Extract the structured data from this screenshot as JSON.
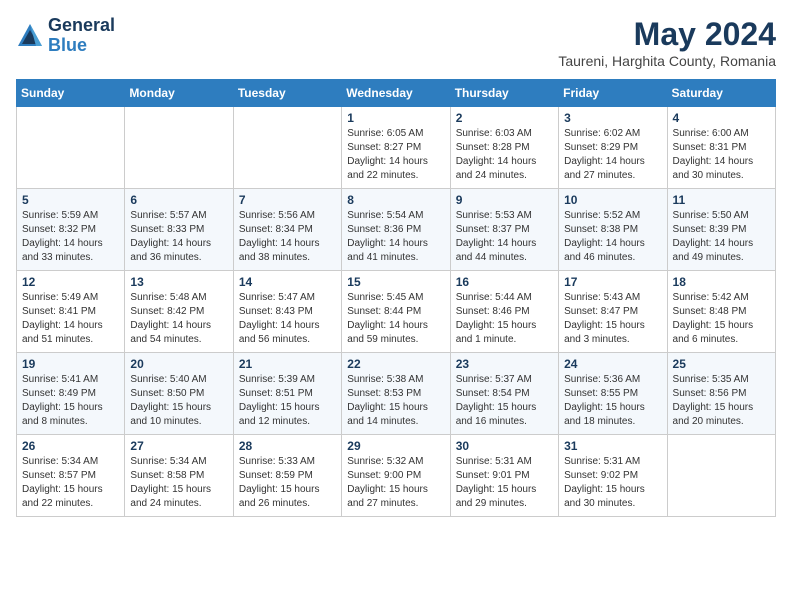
{
  "header": {
    "logo_general": "General",
    "logo_blue": "Blue",
    "month_title": "May 2024",
    "location": "Taureni, Harghita County, Romania"
  },
  "days_of_week": [
    "Sunday",
    "Monday",
    "Tuesday",
    "Wednesday",
    "Thursday",
    "Friday",
    "Saturday"
  ],
  "weeks": [
    [
      {
        "day": "",
        "info": ""
      },
      {
        "day": "",
        "info": ""
      },
      {
        "day": "",
        "info": ""
      },
      {
        "day": "1",
        "info": "Sunrise: 6:05 AM\nSunset: 8:27 PM\nDaylight: 14 hours\nand 22 minutes."
      },
      {
        "day": "2",
        "info": "Sunrise: 6:03 AM\nSunset: 8:28 PM\nDaylight: 14 hours\nand 24 minutes."
      },
      {
        "day": "3",
        "info": "Sunrise: 6:02 AM\nSunset: 8:29 PM\nDaylight: 14 hours\nand 27 minutes."
      },
      {
        "day": "4",
        "info": "Sunrise: 6:00 AM\nSunset: 8:31 PM\nDaylight: 14 hours\nand 30 minutes."
      }
    ],
    [
      {
        "day": "5",
        "info": "Sunrise: 5:59 AM\nSunset: 8:32 PM\nDaylight: 14 hours\nand 33 minutes."
      },
      {
        "day": "6",
        "info": "Sunrise: 5:57 AM\nSunset: 8:33 PM\nDaylight: 14 hours\nand 36 minutes."
      },
      {
        "day": "7",
        "info": "Sunrise: 5:56 AM\nSunset: 8:34 PM\nDaylight: 14 hours\nand 38 minutes."
      },
      {
        "day": "8",
        "info": "Sunrise: 5:54 AM\nSunset: 8:36 PM\nDaylight: 14 hours\nand 41 minutes."
      },
      {
        "day": "9",
        "info": "Sunrise: 5:53 AM\nSunset: 8:37 PM\nDaylight: 14 hours\nand 44 minutes."
      },
      {
        "day": "10",
        "info": "Sunrise: 5:52 AM\nSunset: 8:38 PM\nDaylight: 14 hours\nand 46 minutes."
      },
      {
        "day": "11",
        "info": "Sunrise: 5:50 AM\nSunset: 8:39 PM\nDaylight: 14 hours\nand 49 minutes."
      }
    ],
    [
      {
        "day": "12",
        "info": "Sunrise: 5:49 AM\nSunset: 8:41 PM\nDaylight: 14 hours\nand 51 minutes."
      },
      {
        "day": "13",
        "info": "Sunrise: 5:48 AM\nSunset: 8:42 PM\nDaylight: 14 hours\nand 54 minutes."
      },
      {
        "day": "14",
        "info": "Sunrise: 5:47 AM\nSunset: 8:43 PM\nDaylight: 14 hours\nand 56 minutes."
      },
      {
        "day": "15",
        "info": "Sunrise: 5:45 AM\nSunset: 8:44 PM\nDaylight: 14 hours\nand 59 minutes."
      },
      {
        "day": "16",
        "info": "Sunrise: 5:44 AM\nSunset: 8:46 PM\nDaylight: 15 hours\nand 1 minute."
      },
      {
        "day": "17",
        "info": "Sunrise: 5:43 AM\nSunset: 8:47 PM\nDaylight: 15 hours\nand 3 minutes."
      },
      {
        "day": "18",
        "info": "Sunrise: 5:42 AM\nSunset: 8:48 PM\nDaylight: 15 hours\nand 6 minutes."
      }
    ],
    [
      {
        "day": "19",
        "info": "Sunrise: 5:41 AM\nSunset: 8:49 PM\nDaylight: 15 hours\nand 8 minutes."
      },
      {
        "day": "20",
        "info": "Sunrise: 5:40 AM\nSunset: 8:50 PM\nDaylight: 15 hours\nand 10 minutes."
      },
      {
        "day": "21",
        "info": "Sunrise: 5:39 AM\nSunset: 8:51 PM\nDaylight: 15 hours\nand 12 minutes."
      },
      {
        "day": "22",
        "info": "Sunrise: 5:38 AM\nSunset: 8:53 PM\nDaylight: 15 hours\nand 14 minutes."
      },
      {
        "day": "23",
        "info": "Sunrise: 5:37 AM\nSunset: 8:54 PM\nDaylight: 15 hours\nand 16 minutes."
      },
      {
        "day": "24",
        "info": "Sunrise: 5:36 AM\nSunset: 8:55 PM\nDaylight: 15 hours\nand 18 minutes."
      },
      {
        "day": "25",
        "info": "Sunrise: 5:35 AM\nSunset: 8:56 PM\nDaylight: 15 hours\nand 20 minutes."
      }
    ],
    [
      {
        "day": "26",
        "info": "Sunrise: 5:34 AM\nSunset: 8:57 PM\nDaylight: 15 hours\nand 22 minutes."
      },
      {
        "day": "27",
        "info": "Sunrise: 5:34 AM\nSunset: 8:58 PM\nDaylight: 15 hours\nand 24 minutes."
      },
      {
        "day": "28",
        "info": "Sunrise: 5:33 AM\nSunset: 8:59 PM\nDaylight: 15 hours\nand 26 minutes."
      },
      {
        "day": "29",
        "info": "Sunrise: 5:32 AM\nSunset: 9:00 PM\nDaylight: 15 hours\nand 27 minutes."
      },
      {
        "day": "30",
        "info": "Sunrise: 5:31 AM\nSunset: 9:01 PM\nDaylight: 15 hours\nand 29 minutes."
      },
      {
        "day": "31",
        "info": "Sunrise: 5:31 AM\nSunset: 9:02 PM\nDaylight: 15 hours\nand 30 minutes."
      },
      {
        "day": "",
        "info": ""
      }
    ]
  ]
}
